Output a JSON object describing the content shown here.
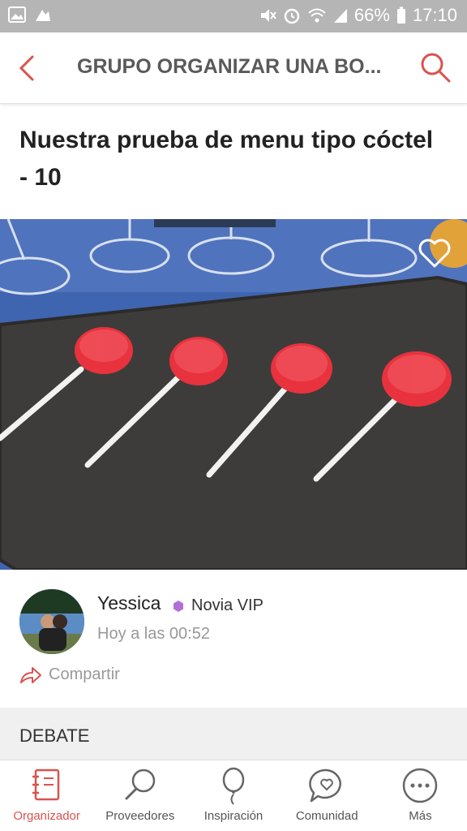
{
  "status_bar": {
    "battery": "66%",
    "time": "17:10"
  },
  "header": {
    "title": "GRUPO ORGANIZAR UNA BO...",
    "back_icon": "chevron-left-icon",
    "search_icon": "search-icon"
  },
  "post": {
    "title": "Nuestra prueba de menu tipo cóctel - 10"
  },
  "author": {
    "name": "Yessica",
    "badge": "Novia VIP",
    "timestamp": "Hoy a las 00:52",
    "share_label": "Compartir"
  },
  "debate": {
    "label": "DEBATE"
  },
  "bottom_nav": {
    "items": [
      {
        "label": "Organizador",
        "icon": "notebook-icon",
        "active": true
      },
      {
        "label": "Proveedores",
        "icon": "magnifier-icon",
        "active": false
      },
      {
        "label": "Inspiración",
        "icon": "balloon-icon",
        "active": false
      },
      {
        "label": "Comunidad",
        "icon": "chat-heart-icon",
        "active": false
      },
      {
        "label": "Más",
        "icon": "more-icon",
        "active": false
      }
    ]
  },
  "colors": {
    "accent": "#d9534f",
    "badge_purple": "#b36fd9",
    "status_bar": "#b5b5b5"
  }
}
